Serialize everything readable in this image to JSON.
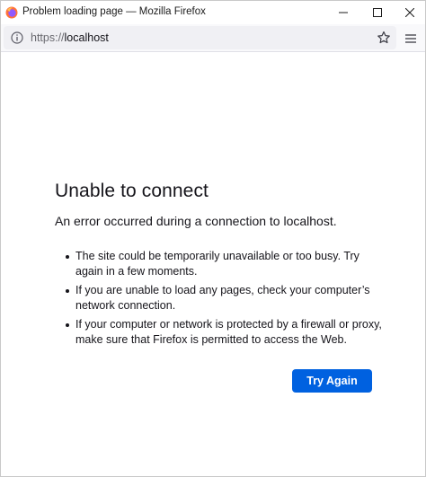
{
  "window": {
    "title": "Problem loading page — Mozilla Firefox",
    "icons": [
      "firefox-logo",
      "minimize-icon",
      "maximize-icon",
      "close-icon"
    ]
  },
  "navbar": {
    "url_scheme": "https://",
    "url_host": "localhost",
    "icons": [
      "info-icon",
      "star-icon",
      "menu-icon"
    ]
  },
  "error": {
    "title": "Unable to connect",
    "subtitle": "An error occurred during a connection to localhost.",
    "items": [
      "The site could be temporarily unavailable or too busy. Try again in a few moments.",
      "If you are unable to load any pages, check your computer’s network connection.",
      "If your computer or network is protected by a firewall or proxy, make sure that Firefox is permitted to access the Web."
    ],
    "button_label": "Try Again"
  },
  "colors": {
    "accent": "#0061e0",
    "urlbar": "#f0f0f4",
    "text": "#15141a"
  }
}
